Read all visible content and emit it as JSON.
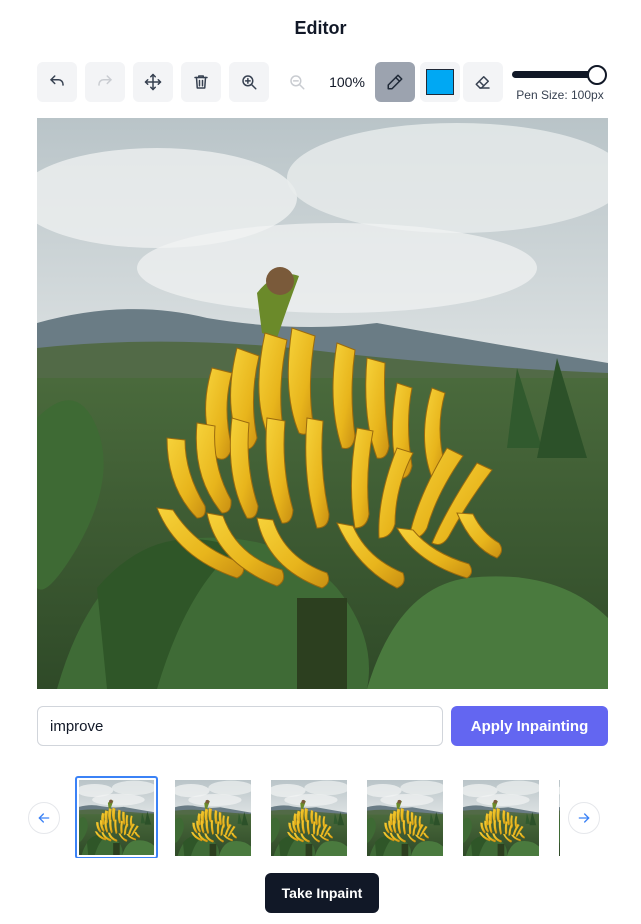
{
  "header": {
    "title": "Editor"
  },
  "toolbar": {
    "undo_icon": "undo-icon",
    "redo_icon": "redo-icon",
    "move_icon": "move-icon",
    "delete_icon": "trash-icon",
    "zoom_in_icon": "zoom-in-icon",
    "zoom_out_icon": "zoom-out-icon",
    "zoom_level": "100%",
    "pen_icon": "pencil-icon",
    "pen_color": "#00a8f3",
    "eraser_icon": "eraser-icon",
    "pen_size_label": "Pen Size: 100px",
    "pen_size_fraction": 1.0
  },
  "prompt": {
    "value": "improve"
  },
  "apply_button": {
    "label": "Apply Inpainting"
  },
  "gallery": {
    "prev_icon": "arrow-left-icon",
    "next_icon": "arrow-right-icon",
    "selected_index": 0,
    "count_visible": 5
  },
  "take_button": {
    "label": "Take Inpaint"
  },
  "colors": {
    "accent": "#6366f1",
    "dark": "#111827",
    "selection": "#3b82f6"
  }
}
